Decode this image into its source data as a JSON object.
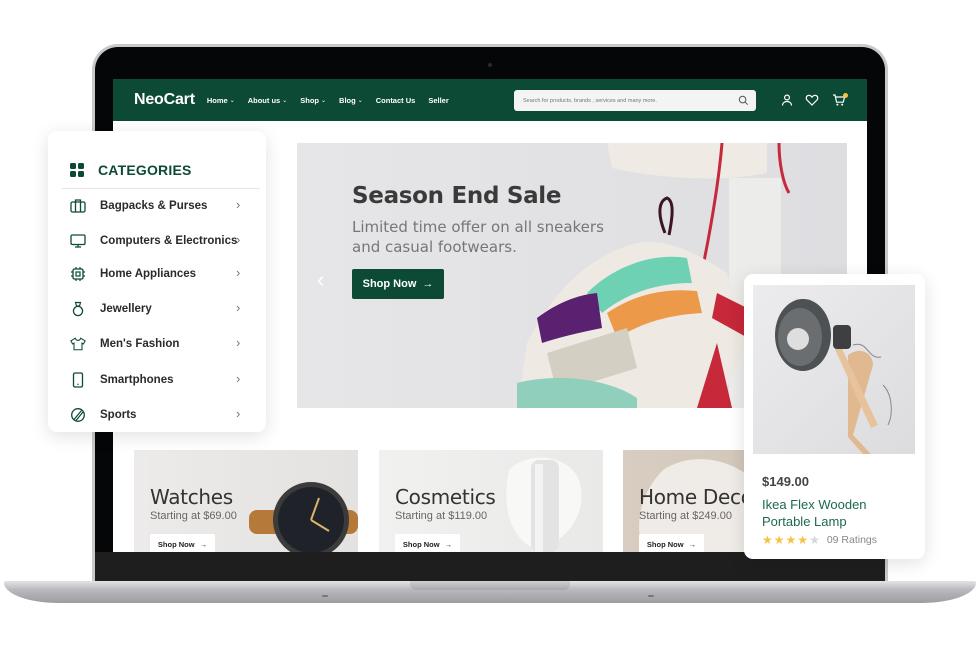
{
  "app": {
    "logo": "NeoCart"
  },
  "nav": {
    "menu": [
      {
        "label": "Home",
        "has_dropdown": true
      },
      {
        "label": "About us",
        "has_dropdown": true
      },
      {
        "label": "Shop",
        "has_dropdown": true
      },
      {
        "label": "Blog",
        "has_dropdown": true
      },
      {
        "label": "Contact Us",
        "has_dropdown": false
      },
      {
        "label": "Seller",
        "has_dropdown": false
      }
    ],
    "search": {
      "placeholder": "Search for products, brands , services and many more.",
      "value": ""
    },
    "icons": [
      "search-icon",
      "user-icon",
      "heart-icon",
      "cart-icon"
    ],
    "cart_has_badge": true
  },
  "hero": {
    "title": "Season End Sale",
    "subtitle": "Limited time offer on all sneakers and casual footwears.",
    "button_label": "Shop Now",
    "button_icon": "→",
    "prev": "‹",
    "next": "›"
  },
  "promos": [
    {
      "title": "Watches",
      "subtitle": "Starting at $69.00",
      "button_label": "Shop Now",
      "arrow": "→"
    },
    {
      "title": "Cosmetics",
      "subtitle": "Starting at $119.00",
      "button_label": "Shop Now",
      "arrow": "→"
    },
    {
      "title": "Home Decor",
      "subtitle": "Starting at $249.00",
      "button_label": "Shop Now",
      "arrow": "→"
    }
  ],
  "categories": {
    "title": "CATEGORIES",
    "items": [
      {
        "label": "Bagpacks & Purses",
        "icon": "briefcase-icon"
      },
      {
        "label": "Computers & Electronics",
        "icon": "monitor-icon"
      },
      {
        "label": "Home Appliances",
        "icon": "chip-icon"
      },
      {
        "label": "Jewellery",
        "icon": "ring-icon"
      },
      {
        "label": "Men's Fashion",
        "icon": "tshirt-icon"
      },
      {
        "label": "Smartphones",
        "icon": "smartphone-icon"
      },
      {
        "label": "Sports",
        "icon": "ball-icon"
      }
    ],
    "arrow": "›"
  },
  "product": {
    "price": "$149.00",
    "name": "Ikea Flex Wooden Portable Lamp",
    "rating": 4,
    "rating_max": 5,
    "ratings_count": "09 Ratings"
  },
  "colors": {
    "brand_green": "#0d4a36",
    "link_green": "#1c6a4c",
    "star": "#f5c242",
    "star_empty": "#d6d6d6"
  }
}
